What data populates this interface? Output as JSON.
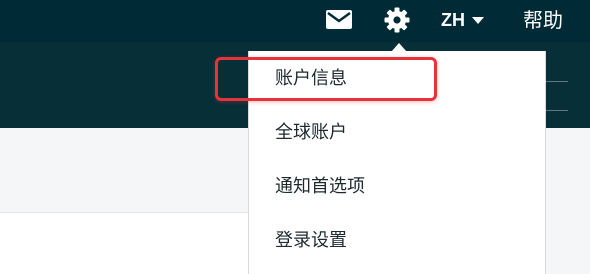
{
  "header": {
    "mail_icon": "mail-icon",
    "settings_icon": "gear-icon",
    "language": "ZH",
    "help_label": "帮助"
  },
  "settings_menu": {
    "items": [
      {
        "label": "账户信息",
        "highlighted": true
      },
      {
        "label": "全球账户",
        "highlighted": false
      },
      {
        "label": "通知首选项",
        "highlighted": false
      },
      {
        "label": "登录设置",
        "highlighted": false
      }
    ]
  },
  "colors": {
    "header_bg": "#002b36",
    "subheader_bg": "#062f38",
    "highlight": "#e5333b"
  }
}
